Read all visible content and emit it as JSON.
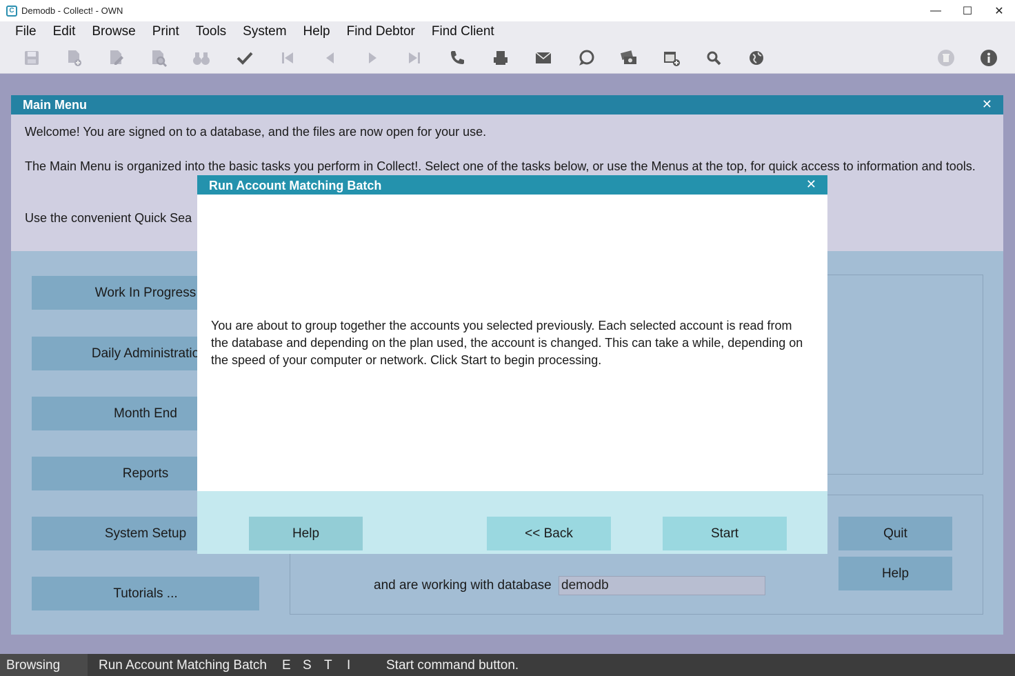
{
  "window": {
    "title": "Demodb - Collect! - OWN",
    "app_icon_letter": "C",
    "minimize_glyph": "—",
    "maximize_glyph": "☐",
    "close_glyph": "✕"
  },
  "menubar": {
    "items": [
      "File",
      "Edit",
      "Browse",
      "Print",
      "Tools",
      "System",
      "Help",
      "Find Debtor",
      "Find Client"
    ]
  },
  "toolbar": {
    "icons": [
      "save-icon",
      "new-record-icon",
      "edit-record-icon",
      "preview-icon",
      "binoculars-icon",
      "check-icon",
      "first-record-icon",
      "previous-record-icon",
      "next-record-icon",
      "last-record-icon",
      "phone-icon",
      "print-icon",
      "email-icon",
      "chat-icon",
      "payment-icon",
      "calendar-add-icon",
      "search-icon",
      "globe-icon",
      "trash-icon",
      "info-icon"
    ]
  },
  "main_menu": {
    "title": "Main Menu",
    "close_glyph": "✕",
    "welcome_line1": "Welcome! You are signed on to a database, and the files are now open for your use.",
    "welcome_line2": "The Main Menu is organized into the basic tasks you perform in Collect!. Select one of the tasks below, or use the Menus at the top, for quick access to information and tools.",
    "welcome_line3": "Use the convenient Quick Sea",
    "buttons": {
      "work_in_progress": "Work In Progress",
      "daily_admin": "Daily Administratio",
      "month_end": "Month End",
      "reports": "Reports",
      "system_setup": "System Setup",
      "tutorials": "Tutorials ..."
    },
    "quit_label": "Quit",
    "help_label": "Help",
    "db_label": "and are working with database",
    "db_value": "demodb"
  },
  "dialog": {
    "title": "Run Account Matching Batch",
    "close_glyph": "✕",
    "message": "You are about to group together the accounts you selected previously. Each selected account is read from the database and depending on the plan used, the account is changed. This can take a while, depending on the speed of your computer or network. Click Start to begin processing.",
    "help_label": "Help",
    "back_label": "<< Back",
    "start_label": "Start"
  },
  "statusbar": {
    "mode": "Browsing",
    "context": "Run Account Matching Batch",
    "flag_e": "E",
    "flag_s": "S",
    "flag_t": "T",
    "flag_i": "I",
    "hint": "Start command button."
  }
}
